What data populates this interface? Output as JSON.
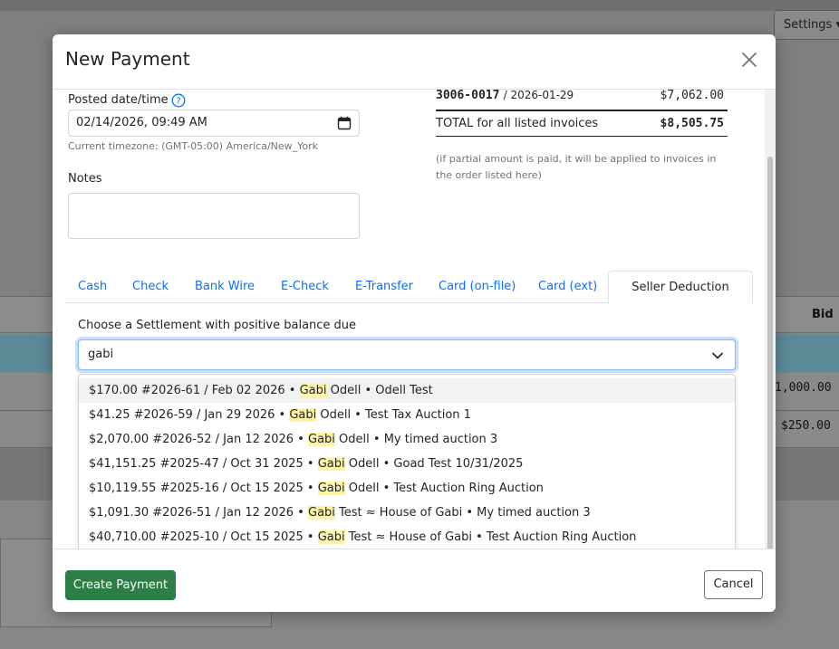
{
  "background": {
    "settings_label": "Settings ▾",
    "bid_header": "Bid",
    "row_values": [
      "1,000.00",
      "$250.00"
    ]
  },
  "modal": {
    "title": "New Payment",
    "posted_label": "Posted date/time",
    "posted_value": "02/14/2026, 09:49 AM",
    "timezone_note": "Current timezone: (GMT-05:00) America/New_York",
    "notes_label": "Notes",
    "invoice": {
      "number": "3006-0017",
      "date": "/ 2026-01-29",
      "amount": "$7,062.00",
      "total_label": "TOTAL for all listed invoices",
      "total_amount": "$8,505.75",
      "partial_note": "(if partial amount is paid, it will be applied to invoices in the order listed here)"
    },
    "tabs": [
      "Cash",
      "Check",
      "Bank Wire",
      "E-Check",
      "E-Transfer",
      "Card (on-file)",
      "Card (ext)",
      "Seller Deduction"
    ],
    "active_tab": "Seller Deduction",
    "choose_label": "Choose a Settlement with positive balance due",
    "search_value": "gabi",
    "options": [
      {
        "pre": "$170.00  #2026-61 / Feb 02 2026 • ",
        "mark": "Gabi",
        "post": " Odell • Odell Test"
      },
      {
        "pre": "$41.25  #2026-59 / Jan 29 2026 • ",
        "mark": "Gabi",
        "post": " Odell • Test Tax Auction 1"
      },
      {
        "pre": "$2,070.00  #2026-52 / Jan 12 2026 • ",
        "mark": "Gabi",
        "post": " Odell • My timed auction 3"
      },
      {
        "pre": "$41,151.25  #2025-47 / Oct 31 2025 • ",
        "mark": "Gabi",
        "post": " Odell • Goad Test 10/31/2025"
      },
      {
        "pre": "$10,119.55  #2025-16 / Oct 15 2025 • ",
        "mark": "Gabi",
        "post": " Odell • Test Auction Ring Auction"
      },
      {
        "pre": "$1,091.30  #2026-51 / Jan 12 2026 • ",
        "mark": "Gabi",
        "post": " Test ≈ House of Gabi • My timed auction 3"
      },
      {
        "pre": "$40,710.00  #2025-10 / Oct 15 2025 • ",
        "mark": "Gabi",
        "post": " Test ≈ House of Gabi • Test Auction Ring Auction"
      }
    ],
    "create_label": "Create Payment",
    "cancel_label": "Cancel"
  },
  "colors": {
    "primary_link": "#0d6efd",
    "create_button": "#2d7d46",
    "highlight": "#fff3a6"
  }
}
